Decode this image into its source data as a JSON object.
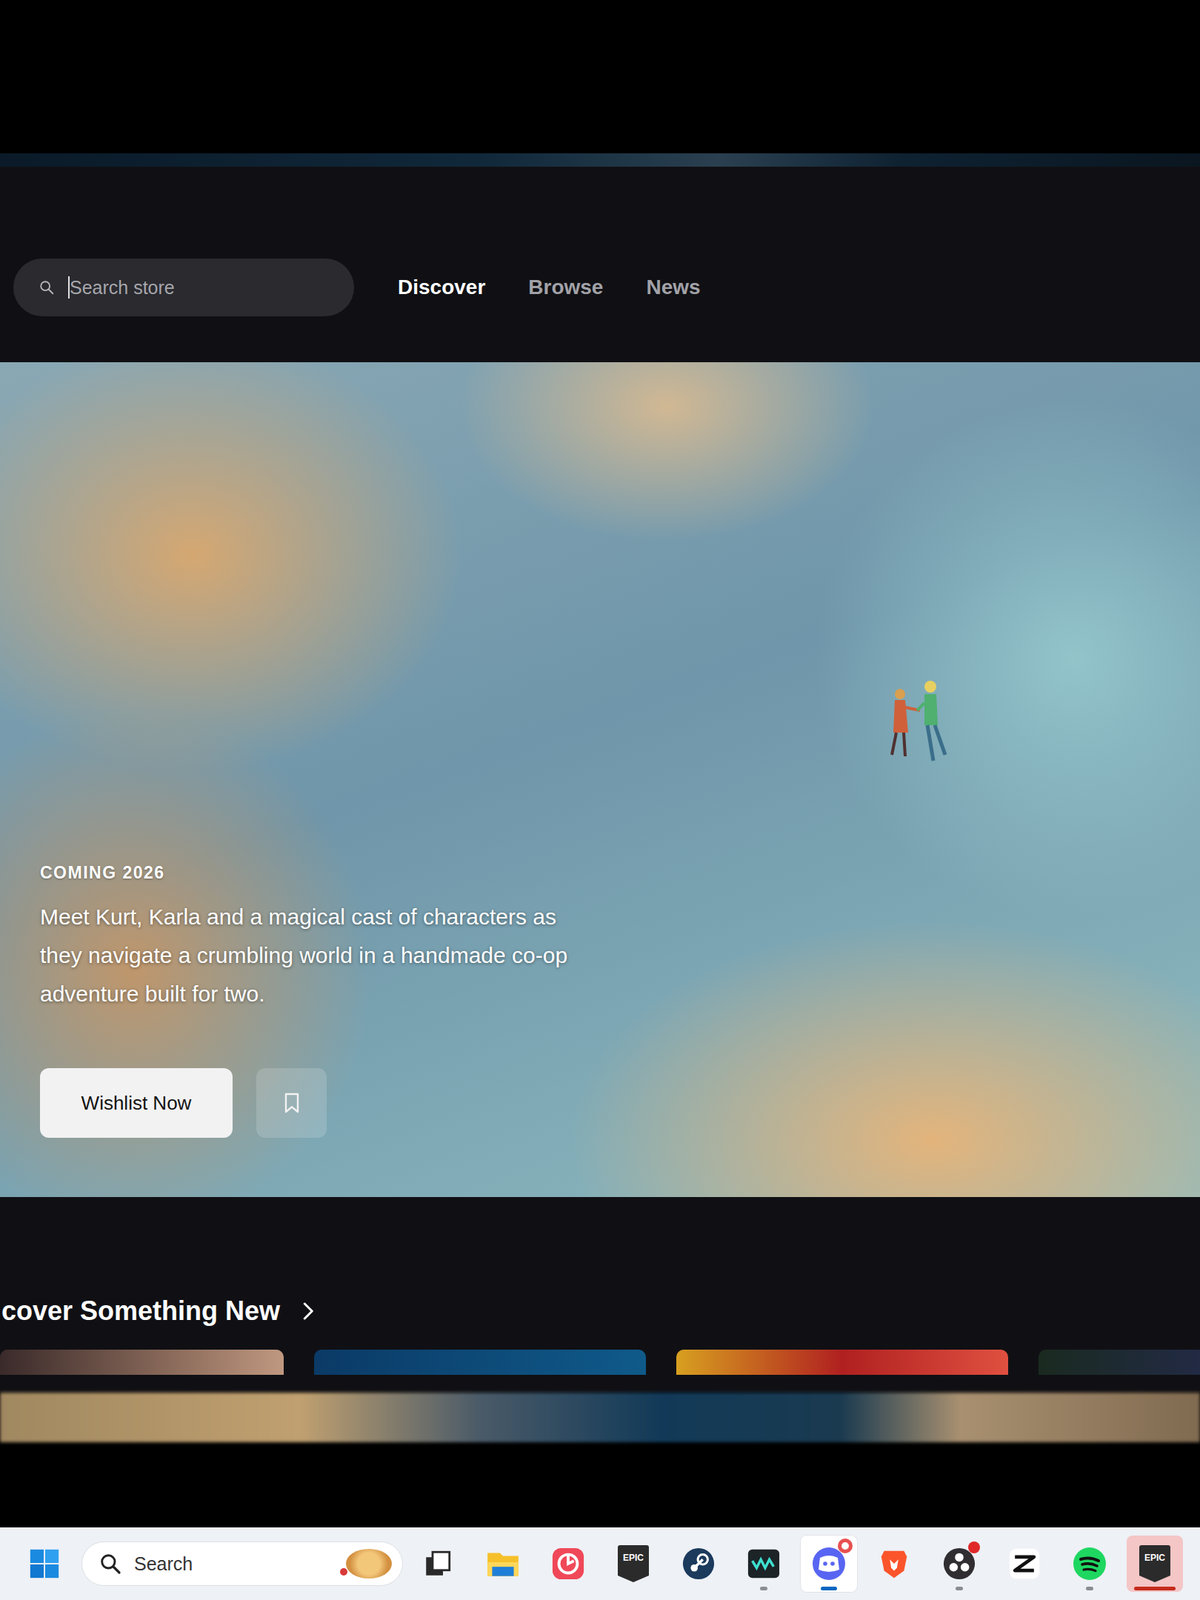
{
  "store": {
    "search": {
      "placeholder": "Search store",
      "focused": true
    },
    "nav": [
      {
        "label": "Discover",
        "selected": true
      },
      {
        "label": "Browse",
        "selected": false
      },
      {
        "label": "News",
        "selected": false
      }
    ]
  },
  "hero": {
    "tag": "COMING 2026",
    "description": "Meet Kurt, Karla and a magical cast of characters as they navigate a crumbling world in a handmade co-op adventure built for two.",
    "primary_button": "Wishlist Now",
    "wishlisted": false
  },
  "section": {
    "title": "cover Something New"
  },
  "taskbar": {
    "search": {
      "placeholder": "Search"
    },
    "apps": [
      {
        "kind": "taskview",
        "running": false,
        "selected": false,
        "attention": false,
        "badge": false
      },
      {
        "kind": "explorer",
        "running": false,
        "selected": false,
        "attention": false,
        "badge": false
      },
      {
        "kind": "music",
        "running": false,
        "selected": false,
        "attention": false,
        "badge": false
      },
      {
        "kind": "epic",
        "label": "EPIC",
        "running": false,
        "selected": false,
        "attention": false,
        "badge": false
      },
      {
        "kind": "steam",
        "running": false,
        "selected": false,
        "attention": false,
        "badge": false
      },
      {
        "kind": "terminal",
        "running": true,
        "selected": false,
        "attention": false,
        "badge": false
      },
      {
        "kind": "discord",
        "running": true,
        "selected": true,
        "attention": false,
        "badge": true
      },
      {
        "kind": "brave",
        "running": false,
        "selected": false,
        "attention": false,
        "badge": false
      },
      {
        "kind": "obs",
        "running": true,
        "selected": false,
        "attention": false,
        "badge": true
      },
      {
        "kind": "capcut",
        "running": false,
        "selected": false,
        "attention": false,
        "badge": false
      },
      {
        "kind": "spotify",
        "running": true,
        "selected": false,
        "attention": false,
        "badge": false
      },
      {
        "kind": "epic",
        "label": "EPIC",
        "running": true,
        "selected": false,
        "attention": true,
        "badge": false
      }
    ]
  }
}
